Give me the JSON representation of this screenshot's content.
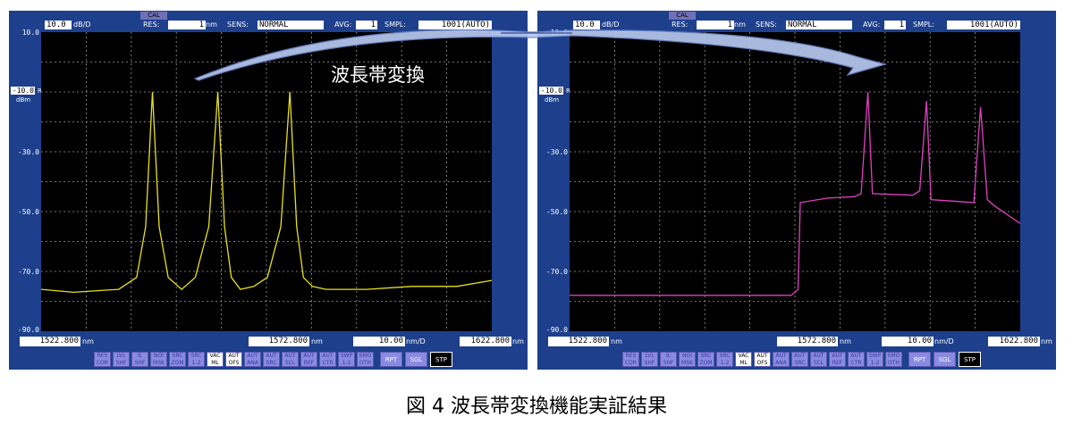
{
  "header": {
    "scale_value": "10.0",
    "scale_unit": "dB/D",
    "cal": "CAL",
    "res_label": "RES:",
    "res_value": "1",
    "res_unit": "nm",
    "sens_label": "SENS:",
    "sens_value": "NORMAL",
    "avg_label": "AVG:",
    "avg_value": "1",
    "smpl_label": "SMPL:",
    "smpl_value": "1001(AUTO)"
  },
  "y_axis": {
    "top": "10.0",
    "ref_value": "-10.0",
    "ref_label": "REF",
    "ref_unit": "dBm",
    "ticks": [
      "-30.0",
      "-50.0",
      "-70.0",
      "-90.0"
    ]
  },
  "x_axis": {
    "start": "1522.800",
    "center": "1572.800",
    "span": "10.00",
    "stop": "1622.800",
    "unit": "nm",
    "span_unit": "nm/D"
  },
  "function_buttons": [
    {
      "label": "RES COR"
    },
    {
      "label": "LVL SHF"
    },
    {
      "label": "IL SHF"
    },
    {
      "label": "NOI MSK"
    },
    {
      "label": "SRC ZOM"
    },
    {
      "label": "SRC 1-2"
    },
    {
      "label": "VAC ML"
    },
    {
      "label": "AUT OFS"
    },
    {
      "label": "AUT ANA"
    },
    {
      "label": "AUT SRC"
    },
    {
      "label": "AUT SCL"
    },
    {
      "label": "AUT REF"
    },
    {
      "label": "AUT CTR"
    },
    {
      "label": "SWP 1-2"
    },
    {
      "label": "SMO OTH"
    }
  ],
  "run_buttons": {
    "rpt": "RPT",
    "sgl": "SGL",
    "stp": "STP"
  },
  "overlay_label": "波長帯変換",
  "caption": "図 4  波長帯変換機能実証結果",
  "trace_colors": {
    "before": "#e8e020",
    "after": "#e040c0"
  },
  "chart_data": [
    {
      "type": "line",
      "name": "before",
      "xlim": [
        1522.8,
        1622.8
      ],
      "ylim": [
        -90,
        10
      ],
      "x": [
        1522.8,
        1530,
        1540,
        1544,
        1546,
        1547.5,
        1549,
        1551,
        1554,
        1557,
        1560,
        1562,
        1563.5,
        1565,
        1567,
        1570,
        1573,
        1576,
        1578,
        1579.5,
        1581,
        1583,
        1586,
        1595,
        1605,
        1615,
        1622.8
      ],
      "y": [
        -76,
        -77,
        -76,
        -72,
        -55,
        -10,
        -55,
        -72,
        -76,
        -72,
        -55,
        -10,
        -55,
        -72,
        -76,
        -75,
        -72,
        -55,
        -10,
        -55,
        -72,
        -75,
        -76,
        -76,
        -75,
        -75,
        -73
      ]
    },
    {
      "type": "line",
      "name": "after",
      "xlim": [
        1522.8,
        1622.8
      ],
      "ylim": [
        -90,
        10
      ],
      "x": [
        1522.8,
        1535,
        1550,
        1565,
        1572,
        1573.5,
        1574,
        1580,
        1586,
        1587.5,
        1589,
        1590,
        1599,
        1600.5,
        1602,
        1603,
        1608,
        1612.5,
        1614,
        1615.5,
        1617,
        1622.8
      ],
      "y": [
        -78,
        -78,
        -78,
        -78,
        -78,
        -76,
        -47,
        -45.5,
        -45,
        -44,
        -10,
        -44,
        -44.5,
        -43,
        -13,
        -46,
        -46.5,
        -47,
        -15,
        -46,
        -48,
        -54
      ]
    }
  ]
}
